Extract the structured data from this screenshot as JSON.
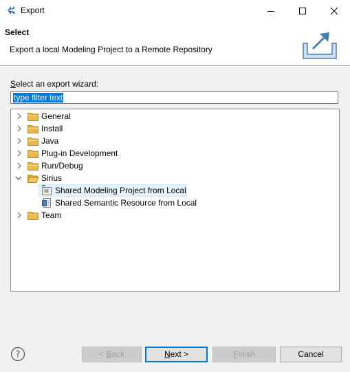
{
  "window": {
    "title": "Export"
  },
  "header": {
    "title": "Select",
    "description": "Export a local Modeling Project to a Remote Repository"
  },
  "wizard": {
    "label_underlined": "S",
    "label_rest": "elect an export wizard:",
    "filter_text": "type filter text"
  },
  "tree": {
    "items": [
      {
        "label": "General"
      },
      {
        "label": "Install"
      },
      {
        "label": "Java"
      },
      {
        "label": "Plug-in Development"
      },
      {
        "label": "Run/Debug"
      },
      {
        "label": "Sirius"
      },
      {
        "label": "Shared Modeling Project from Local"
      },
      {
        "label": "Shared Semantic Resource from Local"
      },
      {
        "label": "Team"
      }
    ]
  },
  "buttons": {
    "back_prefix": "< ",
    "back_underlined": "B",
    "back_rest": "ack",
    "next_underlined": "N",
    "next_rest": "ext >",
    "finish_underlined": "F",
    "finish_rest": "inish",
    "cancel": "Cancel"
  },
  "colors": {
    "selection": "#0078d7",
    "folder": "#e8b84a",
    "row_highlight": "#e5f1fb"
  }
}
